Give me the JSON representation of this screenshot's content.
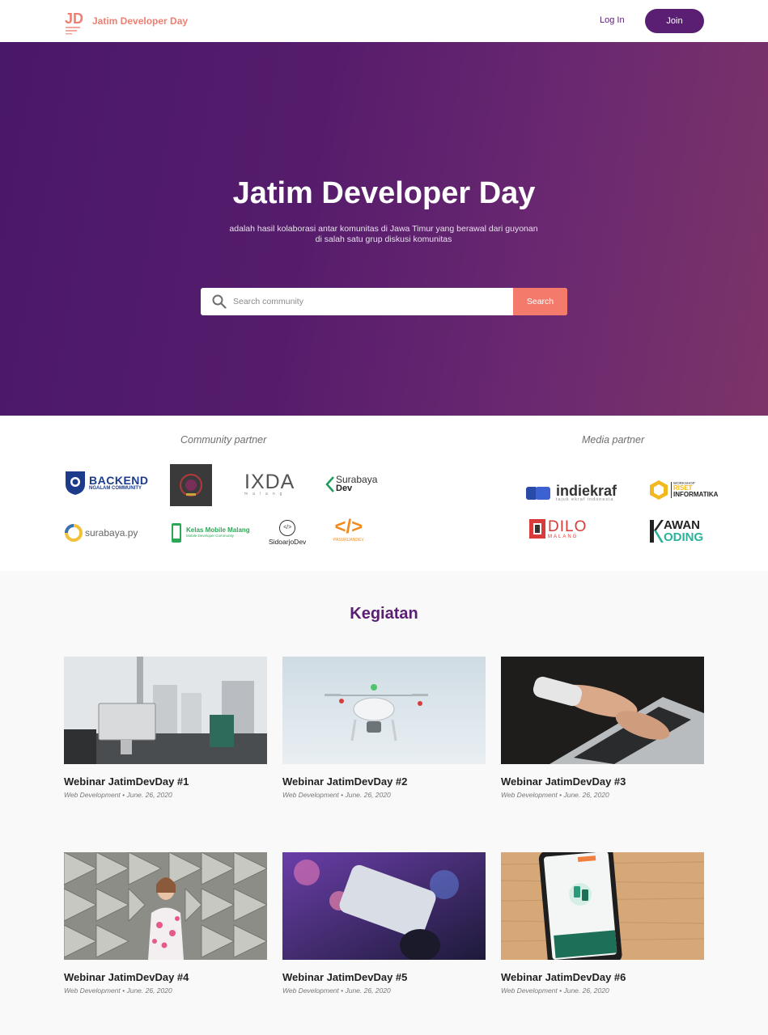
{
  "header": {
    "logo_mark": "JD",
    "brand": "Jatim Developer Day",
    "login_label": "Log In",
    "join_label": "Join"
  },
  "hero": {
    "title": "Jatim Developer Day",
    "subtitle_line1": "adalah hasil kolaborasi antar komunitas di Jawa Timur yang berawal dari guyonan",
    "subtitle_line2": "di salah satu grup diskusi komunitas",
    "search_placeholder": "Search community",
    "search_button": "Search"
  },
  "partners": {
    "community_title": "Community partner",
    "media_title": "Media partner",
    "community_logos": [
      {
        "line1": "BACKEND",
        "line2": "NGALAM COMMUNITY"
      },
      {
        "line1": ""
      },
      {
        "line1": "IXDA",
        "line2": "malang"
      },
      {
        "line1": "Surabaya",
        "line2": "Dev"
      },
      {
        "line1": "surabaya.py"
      },
      {
        "line1": "Kelas Mobile Malang",
        "line2": "Mobile Developer Community"
      },
      {
        "line1": "</>",
        "line2": "SidoarjoDev"
      },
      {
        "line1": "</>",
        "line2": "PASURUANDEV"
      }
    ],
    "media_logos": [
      {
        "line1": "indiekraf",
        "line2": "tajuk ekraf indonesia"
      },
      {
        "line1": "WORKSHOP",
        "line2": "RISET",
        "line3": "INFORMATIKA"
      },
      {
        "line1": "DILO",
        "line2": "MALANG"
      },
      {
        "line1": "AWAN",
        "line2": "ODING"
      }
    ]
  },
  "kegiatan": {
    "title": "Kegiatan",
    "cards": [
      {
        "title": "Webinar JatimDevDay #1",
        "meta": "Web Development • June. 26, 2020"
      },
      {
        "title": "Webinar JatimDevDay #2",
        "meta": "Web Development • June. 26, 2020"
      },
      {
        "title": "Webinar JatimDevDay #3",
        "meta": "Web Development • June. 26, 2020"
      },
      {
        "title": "Webinar JatimDevDay #4",
        "meta": "Web Development • June. 26, 2020"
      },
      {
        "title": "Webinar JatimDevDay #5",
        "meta": "Web Development • June. 26, 2020"
      },
      {
        "title": "Webinar JatimDevDay #6",
        "meta": "Web Development • June. 26, 2020"
      }
    ]
  },
  "colors": {
    "brand_purple": "#5a1f73",
    "accent_coral": "#f47a6b",
    "logo_coral": "#ee7f72"
  }
}
